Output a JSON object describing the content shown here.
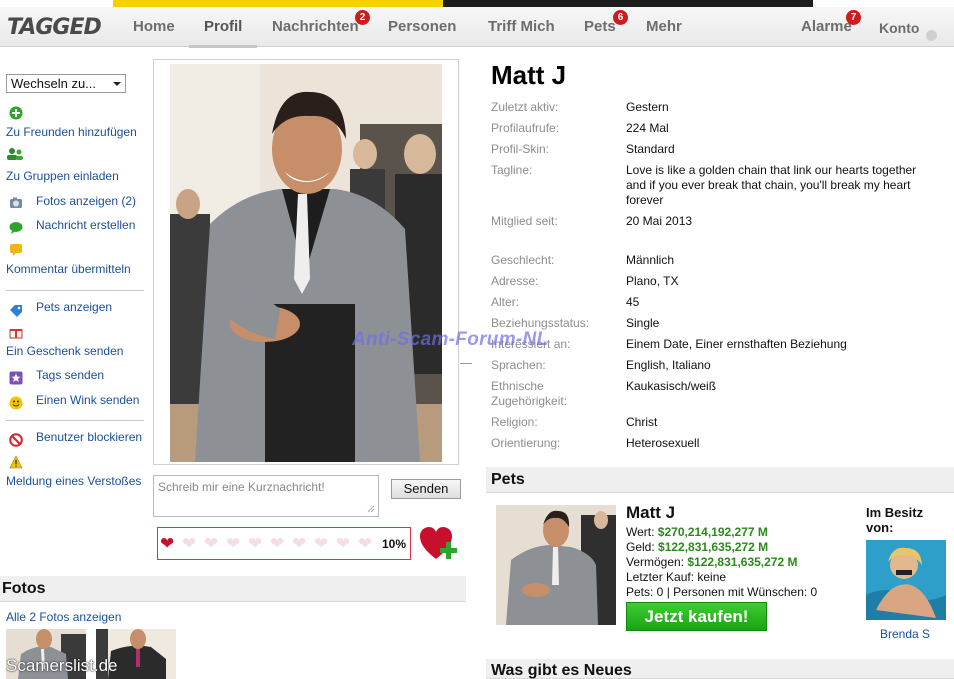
{
  "nav": {
    "logo": "TAGGED",
    "items": [
      {
        "id": "home",
        "label": "Home"
      },
      {
        "id": "profil",
        "label": "Profil"
      },
      {
        "id": "nachrichten",
        "label": "Nachrichten",
        "badge": "2"
      },
      {
        "id": "personen",
        "label": "Personen"
      },
      {
        "id": "triff-mich",
        "label": "Triff Mich"
      },
      {
        "id": "pets",
        "label": "Pets",
        "badge": "6"
      },
      {
        "id": "mehr",
        "label": "Mehr"
      }
    ],
    "alarme": {
      "label": "Alarme",
      "badge": "7"
    },
    "konto": {
      "label": "Konto"
    }
  },
  "sidebar": {
    "switch_select": "Wechseln zu...",
    "actions": [
      {
        "label": "Zu Freunden hinzufügen",
        "icon": "plus-icon"
      },
      {
        "label": "Zu Gruppen einladen",
        "icon": "group-icon"
      },
      {
        "label": "Fotos anzeigen (2)",
        "icon": "camera-icon"
      },
      {
        "label": "Nachricht erstellen",
        "icon": "speech-bubble-icon"
      },
      {
        "label": "Kommentar übermitteln",
        "icon": "comment-icon"
      },
      {
        "label": "Pets anzeigen",
        "icon": "tag-icon"
      },
      {
        "label": "Ein Geschenk senden",
        "icon": "gift-icon"
      },
      {
        "label": "Tags senden",
        "icon": "star-icon"
      },
      {
        "label": "Einen Wink senden",
        "icon": "smiley-icon"
      },
      {
        "label": "Benutzer blockieren",
        "icon": "block-icon"
      },
      {
        "label": "Meldung eines Verstoßes",
        "icon": "warning-icon"
      }
    ]
  },
  "message": {
    "placeholder": "Schreib mir eine Kurznachricht!",
    "send_label": "Senden"
  },
  "hearts": {
    "filled": 1,
    "total": 10,
    "percent_label": "10%"
  },
  "fotos": {
    "title": "Fotos",
    "show_all": "Alle 2 Fotos anzeigen",
    "watermark": "Scamerslist.de"
  },
  "profile": {
    "name": "Matt J",
    "watermark": "Anti-Scam-Forum-NL",
    "fields": [
      {
        "label": "Zuletzt aktiv:",
        "value": "Gestern"
      },
      {
        "label": "Profilaufrufe:",
        "value": "224 Mal"
      },
      {
        "label": "Profil-Skin:",
        "value": "Standard"
      },
      {
        "label": "Tagline:",
        "value": "Love is like a golden chain that link our hearts together and if you ever break that chain, you'll break my heart forever"
      },
      {
        "label": "Mitglied seit:",
        "value": "20 Mai 2013"
      },
      {
        "label": "Geschlecht:",
        "value": "Männlich"
      },
      {
        "label": "Adresse:",
        "value": "Plano, TX"
      },
      {
        "label": "Alter:",
        "value": "45"
      },
      {
        "label": "Beziehungsstatus:",
        "value": "Single"
      },
      {
        "label": "Interessiert an:",
        "value": "Einem Date, Einer ernsthaften Beziehung"
      },
      {
        "label": "Sprachen:",
        "value": "English, Italiano"
      },
      {
        "label": "Ethnische Zugehörigkeit:",
        "value": "Kaukasisch/weiß"
      },
      {
        "label": "Religion:",
        "value": "Christ"
      },
      {
        "label": "Orientierung:",
        "value": "Heterosexuell"
      }
    ]
  },
  "pets": {
    "title": "Pets",
    "name": "Matt J",
    "wert_label": "Wert:",
    "wert": "$270,214,192,277 M",
    "geld_label": "Geld:",
    "geld": "$122,831,635,272 M",
    "vermoegen_label": "Vermögen:",
    "vermoegen": "$122,831,635,272 M",
    "letzter_kauf": "Letzter Kauf: keine",
    "pets_count": "Pets: 0 | Personen mit Wünschen: 0",
    "buy_label": "Jetzt kaufen!",
    "owner_title": "Im Besitz von:",
    "owner_name": "Brenda S"
  },
  "news": {
    "title": "Was gibt es Neues"
  },
  "colors": {
    "link": "#1a4f9c",
    "badge": "#cc1c1c",
    "money_green": "#2a8a1a",
    "buy_button": "#22b01a"
  }
}
